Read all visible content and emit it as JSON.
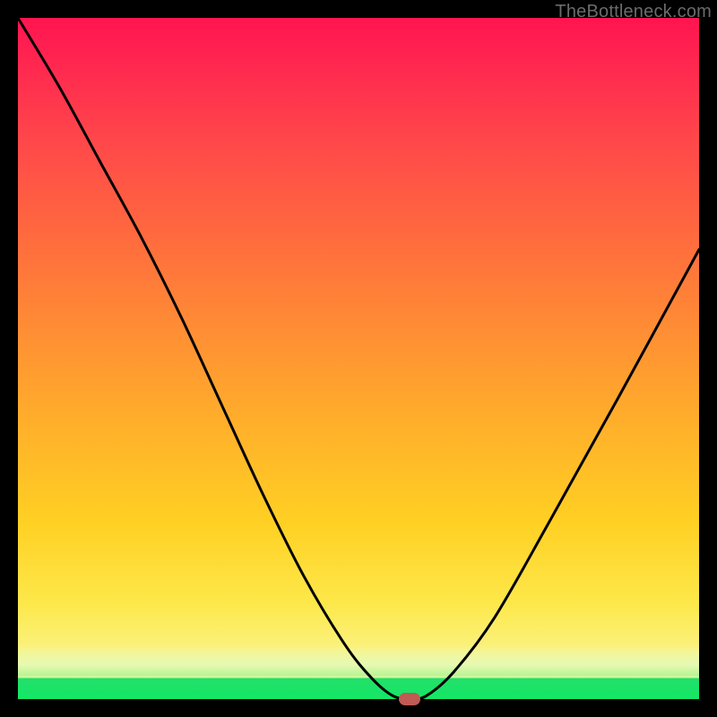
{
  "attribution": "TheBottleneck.com",
  "colors": {
    "frame": "#000000",
    "gradient_top": "#ff1450",
    "gradient_mid": "#ffb02a",
    "gradient_low": "#fbf179",
    "gradient_bottom": "#14e765",
    "curve": "#000000",
    "marker": "#c05a54",
    "attribution_text": "#6b6b6b"
  },
  "chart_data": {
    "type": "line",
    "title": "",
    "xlabel": "",
    "ylabel": "",
    "xlim": [
      0,
      100
    ],
    "ylim": [
      0,
      100
    ],
    "grid": false,
    "legend": false,
    "series": [
      {
        "name": "bottleneck-curve",
        "x": [
          0,
          6,
          12,
          18,
          24,
          30,
          36,
          42,
          48,
          52,
          55,
          57.5,
          60,
          64,
          70,
          78,
          88,
          100
        ],
        "values": [
          100,
          90,
          79,
          68,
          56,
          43,
          30,
          18,
          8,
          3,
          0.5,
          0,
          0.5,
          4,
          12,
          26,
          44,
          66
        ]
      }
    ],
    "marker": {
      "x": 57.5,
      "y": 0
    },
    "background_gradient": {
      "direction": "vertical",
      "stops": [
        {
          "pos": 0.0,
          "color": "#ff1450"
        },
        {
          "pos": 0.32,
          "color": "#ff6a3e"
        },
        {
          "pos": 0.6,
          "color": "#ffb02a"
        },
        {
          "pos": 0.86,
          "color": "#fde84a"
        },
        {
          "pos": 0.95,
          "color": "#f9f6a0"
        },
        {
          "pos": 0.97,
          "color": "#22e06a"
        },
        {
          "pos": 1.0,
          "color": "#14e765"
        }
      ]
    }
  }
}
